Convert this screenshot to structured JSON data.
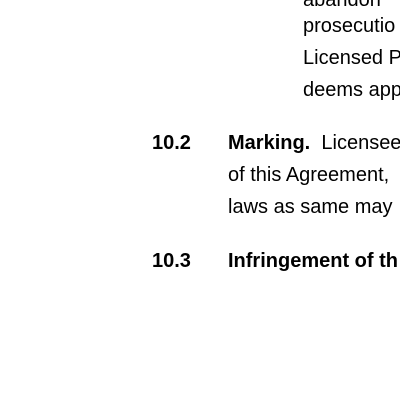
{
  "section_10_1_tail": {
    "lines": [
      "abandon",
      "prosecutio",
      "Licensed P",
      "deems app"
    ]
  },
  "section_10_2": {
    "number": "10.2",
    "heading": "Marking.",
    "line1_rest": "Licensee",
    "line2": "of this Agreement,",
    "line3": "laws as same may"
  },
  "section_10_3": {
    "number": "10.3",
    "heading": "Infringement of th"
  }
}
